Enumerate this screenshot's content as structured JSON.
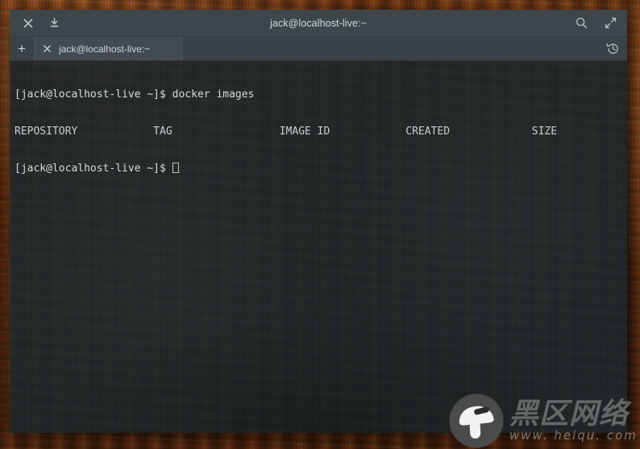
{
  "window": {
    "title": "jack@localhost-live:~",
    "titlebar_buttons": [
      {
        "name": "close-icon",
        "label": "×"
      },
      {
        "name": "download-icon",
        "label": "⤓"
      }
    ],
    "titlebar_right_buttons": [
      {
        "name": "search-icon",
        "label": "search"
      },
      {
        "name": "fullscreen-icon",
        "label": "fullscreen"
      }
    ]
  },
  "tabbar": {
    "new_tab_label": "+",
    "history_label": "history",
    "tabs": [
      {
        "title": "jack@localhost-live:~",
        "close_label": "×",
        "active": true
      }
    ]
  },
  "terminal": {
    "prompt": "[jack@localhost-live ~]$ ",
    "command": "docker images",
    "line1": "[jack@localhost-live ~]$ docker images",
    "columns_line": "REPOSITORY            TAG                 IMAGE ID            CREATED             SIZE",
    "columns": [
      "REPOSITORY",
      "TAG",
      "IMAGE ID",
      "CREATED",
      "SIZE"
    ],
    "prompt_line": "[jack@localhost-live ~]$ ",
    "cursor": "block-outline"
  },
  "watermark": {
    "logo": "mushroom-logo",
    "cn_text": "黑区网络",
    "url_text": "www. heiqu. com"
  },
  "colors": {
    "titlebar": "#3e464b",
    "tabbar": "#3a4247",
    "active_tab": "#434b51",
    "terminal_bg": "#1f2629",
    "terminal_fg": "#d8dcdd",
    "desktop": "#6d3516"
  }
}
